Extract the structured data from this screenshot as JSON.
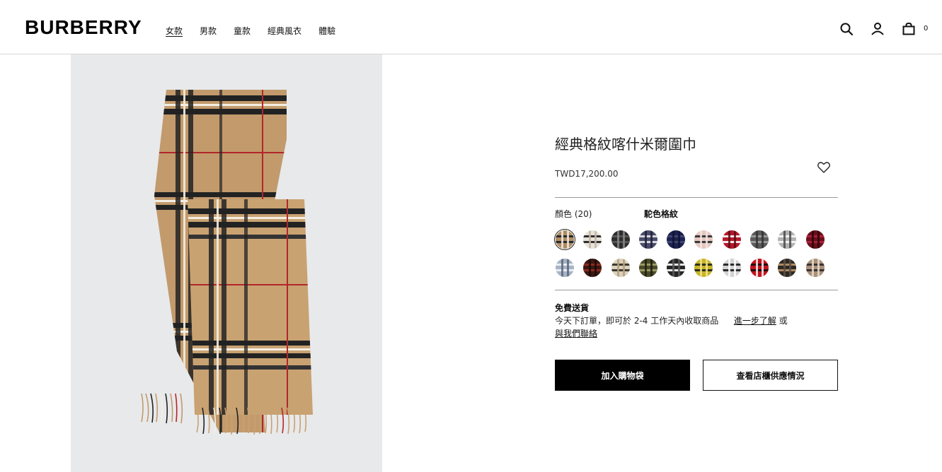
{
  "header": {
    "logo": "BURBERRY",
    "nav": [
      "女款",
      "男款",
      "童款",
      "經典風衣",
      "體驗"
    ],
    "bag_count": "0",
    "icons": [
      "search-icon",
      "account-icon",
      "bag-icon"
    ]
  },
  "product": {
    "title": "經典格紋喀什米爾圍巾",
    "price": "TWD17,200.00",
    "color_label": "顏色 (20)",
    "selected_color": "駝色格紋",
    "swatches": [
      {
        "base": "#b08c62",
        "h": "#2a2a2a",
        "v": "#f0ece4"
      },
      {
        "base": "#e9e4da",
        "h": "#2f2f2f",
        "v": "#bfb6a4"
      },
      {
        "base": "#2d2d2d",
        "h": "#555555",
        "v": "#888888"
      },
      {
        "base": "#4b4e6a",
        "h": "#d8d8e0",
        "v": "#1e2038"
      },
      {
        "base": "#1c2250",
        "h": "#40456f",
        "v": "#0f1233"
      },
      {
        "base": "#e6c7c0",
        "h": "#3a3a3a",
        "v": "#f1e6e2"
      },
      {
        "base": "#b4192a",
        "h": "#f4e9e9",
        "v": "#5a0c14"
      },
      {
        "base": "#5b5b5b",
        "h": "#9a9a9a",
        "v": "#333333"
      },
      {
        "base": "#b3b3b3",
        "h": "#f2f2f2",
        "v": "#4a4a4a"
      },
      {
        "base": "#6b0e1c",
        "h": "#a8203a",
        "v": "#2a0508"
      },
      {
        "base": "#a8b4c4",
        "h": "#e8eef6",
        "v": "#59667a"
      },
      {
        "base": "#3b1812",
        "h": "#8a2a1e",
        "v": "#1a0a06"
      },
      {
        "base": "#d8d2c0",
        "h": "#3a3a32",
        "v": "#b89e76"
      },
      {
        "base": "#4a4a2a",
        "h": "#9a9a62",
        "v": "#1e1e12"
      },
      {
        "base": "#262626",
        "h": "#e8e8e8",
        "v": "#5a5a5a"
      },
      {
        "base": "#c7b42a",
        "h": "#2f2f1a",
        "v": "#f0e58a"
      },
      {
        "base": "#d2d2d2",
        "h": "#2a2a2a",
        "v": "#ffffff"
      },
      {
        "base": "#c2141e",
        "h": "#2a0a0c",
        "v": "#f4f4f4"
      },
      {
        "base": "#2f2a24",
        "h": "#b08c62",
        "v": "#5a5048"
      },
      {
        "base": "#a89078",
        "h": "#3a3230",
        "v": "#e8ddd0"
      }
    ],
    "delivery": {
      "title": "免費送貨",
      "text": "今天下訂單，即可於 2-4 工作天內收取商品",
      "link_more": "進一步了解",
      "or": "或",
      "link_contact": "與我們聯絡"
    },
    "buttons": {
      "add_to_bag": "加入購物袋",
      "check_store": "查看店櫃供應情況"
    }
  },
  "colors": {
    "primary_button": "#000000",
    "image_background": "#e8e9eb"
  }
}
